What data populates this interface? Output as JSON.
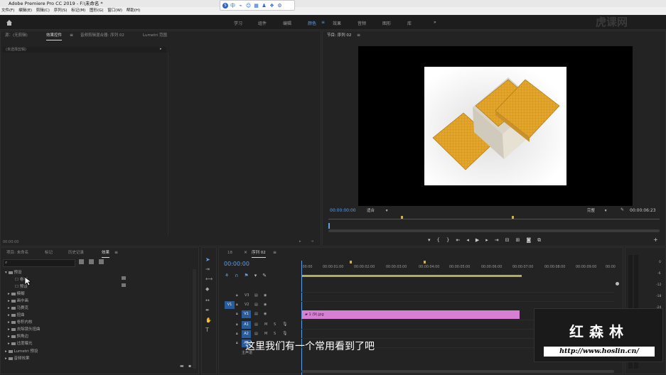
{
  "titlebar": {
    "title": "Adobe Premiere Pro CC 2019 - F:\\未命名 *"
  },
  "menu": [
    "文件(F)",
    "编辑(E)",
    "剪辑(C)",
    "序列(S)",
    "标记(M)",
    "图形(G)",
    "窗口(W)",
    "帮助(H)"
  ],
  "ime": [
    "中",
    "⌁",
    "☺",
    "▦",
    "♟",
    "❖",
    "⚙"
  ],
  "workspaces": [
    "学习",
    "组件",
    "编辑",
    "颜色",
    "效果",
    "音频",
    "图形",
    "库"
  ],
  "workspace_active": "颜色",
  "watermark": "虎课网",
  "source_panel": {
    "tabs": [
      "源：(无剪辑)",
      "效果控件",
      "音频剪辑混合器: 序列 02",
      "Lumetri 范围"
    ],
    "no_clip": "(未选择剪辑)",
    "timecode": "00:00:00"
  },
  "program_panel": {
    "title": "节目: 序列 02",
    "timecode": "00:00:00:00",
    "fit": "适合",
    "quality": "完整",
    "duration": "00:00:06:23"
  },
  "project_panel": {
    "tabs": [
      "项目: 未命名",
      "标记",
      "历史记录",
      "效果"
    ],
    "active_tab": "效果",
    "tree": [
      "预设",
      "卷积",
      "预设",
      "模糊",
      "画中画",
      "马赛克",
      "扭曲",
      "卷积内核",
      "去除镜头扭曲",
      "斜角边",
      "过度曝光",
      "Lumetri 预设",
      "音频效果"
    ]
  },
  "timeline": {
    "tab_close": "18",
    "sequence": "序列 02",
    "timecode": "00:00:00",
    "ruler": [
      ":00:00",
      "00:00:01:00",
      "00:00:02:00",
      "00:00:03:00",
      "00:00:04:00",
      "00:00:05:00",
      "00:00:06:00",
      "00:00:07:00",
      "00:00:08:00",
      "00:00:09:00",
      "00:00"
    ],
    "video_tracks": [
      "V3",
      "V2",
      "V1"
    ],
    "audio_tracks": [
      "A1",
      "A2",
      "A3"
    ],
    "mute": "M",
    "solo": "S",
    "clip_label": "1 (9).jpg",
    "master": "主声道",
    "source_patch": "V1"
  },
  "meter": {
    "values": [
      "0",
      "-6",
      "-12",
      "-18",
      "-24"
    ]
  },
  "subtitle": "这里我们有一个常用看到了吧",
  "brand": {
    "name": "红森林",
    "url": "http://www.hoslin.cn/"
  },
  "colors": {
    "accent": "#5f9fe8",
    "clip": "#d77fd3"
  }
}
